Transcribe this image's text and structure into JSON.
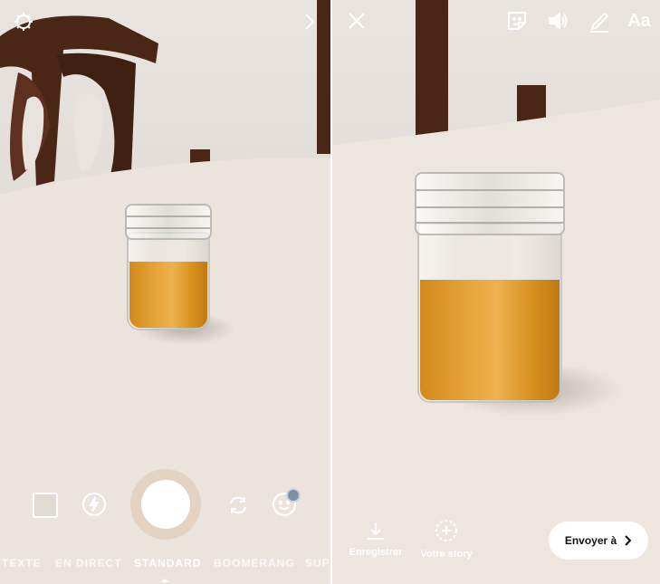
{
  "camera": {
    "modes": [
      "TEXTE",
      "EN DIRECT",
      "STANDARD",
      "BOOMERANG",
      "SUPE"
    ],
    "active_mode": "STANDARD"
  },
  "icons": {
    "settings": "gear-icon",
    "next": "chevron-right-icon",
    "gallery": "gallery-square-icon",
    "flash": "flash-icon",
    "flip": "flip-camera-icon",
    "face_filter": "face-filter-icon",
    "close": "close-icon",
    "sticker": "sticker-icon",
    "sound": "speaker-icon",
    "draw": "pen-icon",
    "save": "download-icon",
    "story": "add-story-icon"
  },
  "editor": {
    "text_tool": "Aa",
    "save_label": "Enregistrer",
    "story_label": "Votre story",
    "send_label": "Envoyer à"
  },
  "colors": {
    "honey": "#e0a03a",
    "shutter_ring": "#e1cdb9",
    "badge": "#7f8fa6"
  }
}
